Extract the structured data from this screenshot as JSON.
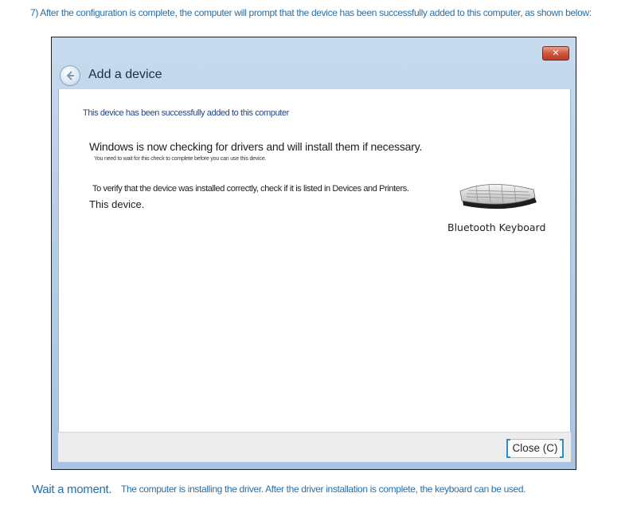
{
  "captions": {
    "top": "7) After the configuration is complete, the computer will prompt that the device has been successfully added to this computer, as shown below:",
    "bottom_lead": "Wait a moment.",
    "bottom_rest": "The computer is installing the driver. After the driver installation is complete, the keyboard can be used."
  },
  "window": {
    "title": "Add a device",
    "close_icon": "close-x-icon",
    "back_icon": "back-arrow-icon",
    "success_message": "This device has been successfully added to this computer",
    "heading": "Windows is now checking for drivers and will install them if necessary.",
    "sub_note": "You need to wait for this check to complete before you can use this device.",
    "verify_text": "To verify that the device was installed correctly, check if it is listed in Devices and Printers.",
    "this_device": "This device.",
    "device": {
      "icon": "keyboard-icon",
      "label": "Bluetooth Keyboard"
    },
    "footer": {
      "close_button": "Close (C)"
    }
  },
  "colors": {
    "caption_blue": "#2b6ea3",
    "titlebar_blue": "#b6cde6",
    "close_red": "#c8452e",
    "focus_blue": "#2f8ec7"
  }
}
